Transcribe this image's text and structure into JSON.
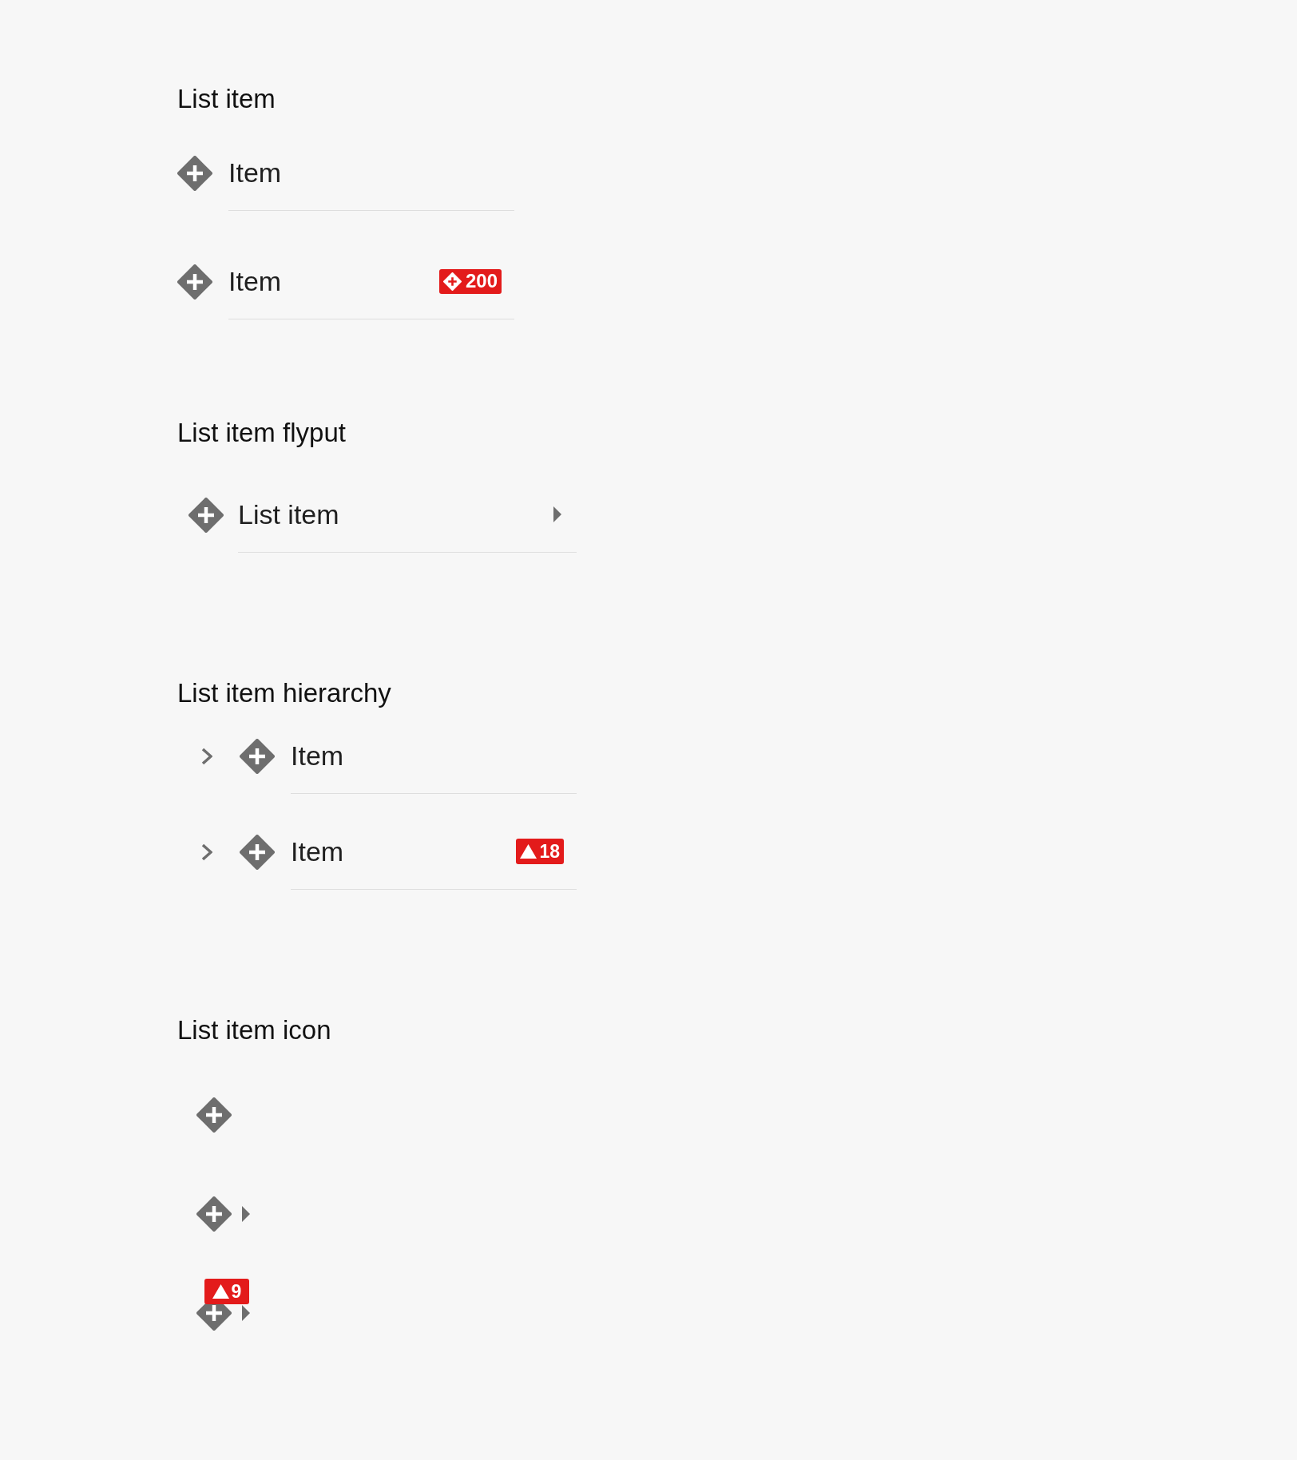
{
  "sections": [
    {
      "kind": "list",
      "title": "List item",
      "items": [
        {
          "label": "Item",
          "flyout": false
        },
        {
          "label": "Item",
          "flyout": false,
          "badge": {
            "kind": "event",
            "text": "200"
          }
        }
      ]
    },
    {
      "kind": "flyout",
      "title": "List item flyput",
      "items": [
        {
          "label": "List item",
          "flyout": true
        }
      ]
    },
    {
      "kind": "hierarchy",
      "title": "List item hierarchy",
      "items": [
        {
          "label": "Item",
          "expanded": false,
          "flyout": false
        },
        {
          "label": "Item",
          "expanded": false,
          "flyout": false,
          "badge": {
            "kind": "warning",
            "text": "18"
          }
        }
      ]
    },
    {
      "kind": "icon",
      "title": "List item icon",
      "items": [
        {
          "flyout": false
        },
        {
          "flyout": true
        },
        {
          "flyout": true,
          "badge": {
            "kind": "warning",
            "text": "9"
          }
        }
      ]
    }
  ]
}
